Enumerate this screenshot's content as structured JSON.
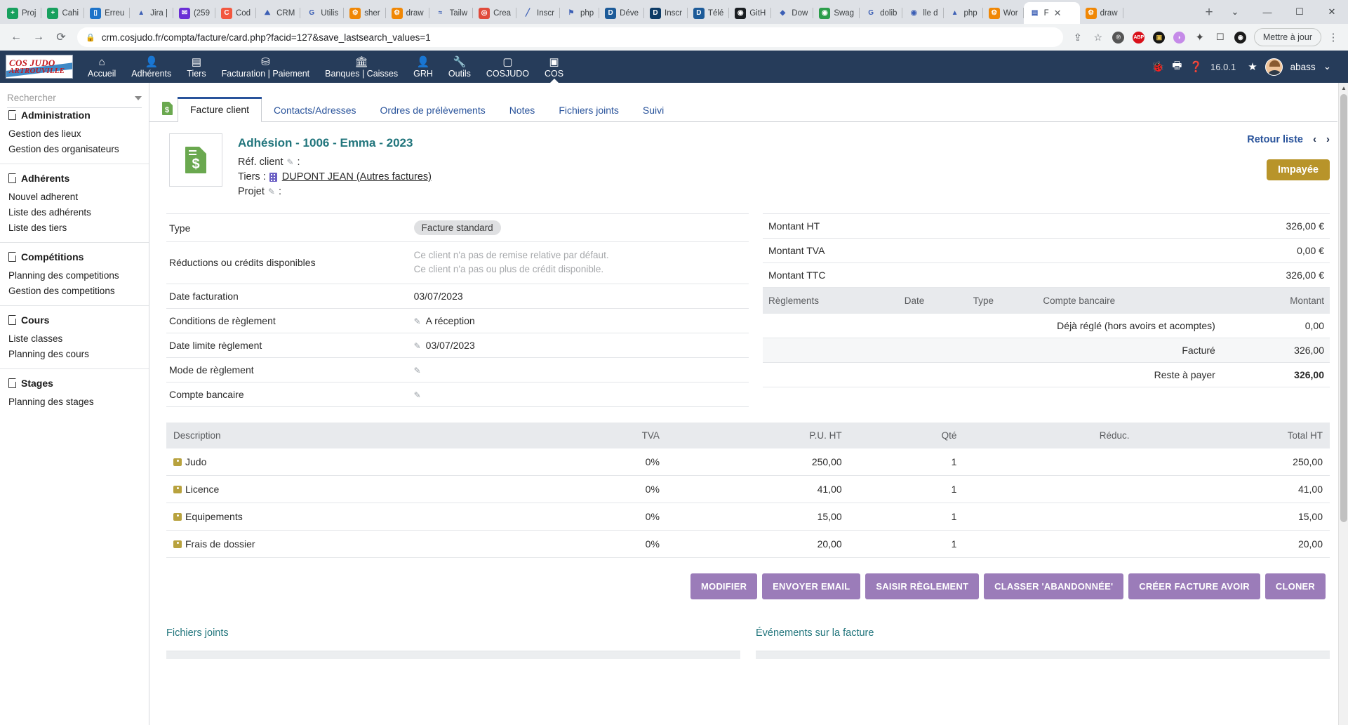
{
  "browser": {
    "tabs": [
      {
        "label": "Proj",
        "icon": "plus-square-green",
        "color": "#17a05e",
        "glyph": "+"
      },
      {
        "label": "Cahi",
        "icon": "plus-square-green",
        "color": "#17a05e",
        "glyph": "+"
      },
      {
        "label": "Erreu",
        "icon": "trello-icon",
        "color": "#1d73c9",
        "glyph": "▯"
      },
      {
        "label": "Jira |",
        "icon": "jira-icon",
        "color": "#ffffff",
        "glyph": "▲"
      },
      {
        "label": "(259",
        "icon": "mail-icon",
        "color": "#6b2fd6",
        "glyph": "✉"
      },
      {
        "label": "Cod",
        "icon": "codepen-icon",
        "color": "#f2573f",
        "glyph": "C"
      },
      {
        "label": "CRM",
        "icon": "crm-icon",
        "color": "#ffffff",
        "glyph": "⛰"
      },
      {
        "label": "Utilis",
        "icon": "google-icon",
        "color": "#ffffff",
        "glyph": "G"
      },
      {
        "label": "sher",
        "icon": "drawio-icon",
        "color": "#f08705",
        "glyph": "⚙"
      },
      {
        "label": "draw",
        "icon": "drawio-icon",
        "color": "#f08705",
        "glyph": "⚙"
      },
      {
        "label": "Tailw",
        "icon": "tailwind-icon",
        "color": "#ffffff",
        "glyph": "≈"
      },
      {
        "label": "Crea",
        "icon": "cred-icon",
        "color": "#e04a3a",
        "glyph": "◎"
      },
      {
        "label": "Inscr",
        "icon": "pen-icon",
        "color": "#ffffff",
        "glyph": "╱"
      },
      {
        "label": "php",
        "icon": "phpmyadmin-icon",
        "color": "#ffffff",
        "glyph": "⚑"
      },
      {
        "label": "Déve",
        "icon": "d-icon",
        "color": "#1d5b99",
        "glyph": "D"
      },
      {
        "label": "Inscr",
        "icon": "d-icon",
        "color": "#0d3b66",
        "glyph": "D"
      },
      {
        "label": "Télé",
        "icon": "d-icon",
        "color": "#1d5b99",
        "glyph": "D"
      },
      {
        "label": "GitH",
        "icon": "github-icon",
        "color": "#1b1f23",
        "glyph": "◉"
      },
      {
        "label": "Dow",
        "icon": "diamond-icon",
        "color": "#ffffff",
        "glyph": "◆"
      },
      {
        "label": "Swag",
        "icon": "swagger-icon",
        "color": "#2c9e4b",
        "glyph": "◉"
      },
      {
        "label": "dolib",
        "icon": "google-icon",
        "color": "#ffffff",
        "glyph": "G"
      },
      {
        "label": "lle d",
        "icon": "maps-pin-icon",
        "color": "#ffffff",
        "glyph": "◉"
      },
      {
        "label": "php",
        "icon": "drive-icon",
        "color": "#ffffff",
        "glyph": "▲"
      },
      {
        "label": "Wor",
        "icon": "drawio-icon",
        "color": "#f08705",
        "glyph": "⚙"
      },
      {
        "label": "F",
        "icon": "cosjudo-favicon",
        "color": "#ffffff",
        "glyph": "▤",
        "active": true
      },
      {
        "label": "draw",
        "icon": "drawio-icon",
        "color": "#f08705",
        "glyph": "⚙"
      }
    ],
    "newtab_label": "+",
    "window_controls": [
      "⌄",
      "—",
      "☐",
      "✕"
    ],
    "back_label": "←",
    "forward_label": "→",
    "reload_label": "⟳",
    "url": "crm.cosjudo.fr/compta/facture/card.php?facid=127&save_lastsearch_values=1",
    "lock_label": "🔒",
    "toolbar_icons": [
      {
        "name": "share-icon",
        "glyph": "⇪"
      },
      {
        "name": "bookmark-star-icon",
        "glyph": "☆"
      },
      {
        "name": "pinterest-extension-icon",
        "glyph": "◉"
      },
      {
        "name": "adblock-plus-icon",
        "glyph": "ABP"
      },
      {
        "name": "lion-extension-icon",
        "glyph": "▣"
      },
      {
        "name": "color-extension-icon",
        "glyph": "◗"
      },
      {
        "name": "extensions-puzzle-icon",
        "glyph": "✦"
      },
      {
        "name": "square-extension-icon",
        "glyph": "☐"
      },
      {
        "name": "dark-extension-icon",
        "glyph": "◉"
      }
    ],
    "update_label": "Mettre à jour",
    "menu_label": "⋮"
  },
  "app_header": {
    "logo_line1": "COS  JUDO",
    "logo_line2": "ARTROUVILLE",
    "nav": [
      {
        "label": "Accueil",
        "icon": "home-icon",
        "glyph": "⌂",
        "active": false
      },
      {
        "label": "Adhérents",
        "icon": "user-icon",
        "glyph": "👤",
        "active": false
      },
      {
        "label": "Tiers",
        "icon": "building-icon",
        "glyph": "▤",
        "active": false
      },
      {
        "label": "Facturation | Paiement",
        "icon": "coins-icon",
        "glyph": "⛁",
        "active": false
      },
      {
        "label": "Banques | Caisses",
        "icon": "bank-icon",
        "glyph": "🏛",
        "active": false
      },
      {
        "label": "GRH",
        "icon": "person-icon",
        "glyph": "👤",
        "active": false
      },
      {
        "label": "Outils",
        "icon": "wrench-icon",
        "glyph": "🔧",
        "active": false
      },
      {
        "label": "COSJUDO",
        "icon": "page-icon",
        "glyph": "▢",
        "active": false
      },
      {
        "label": "COS",
        "icon": "page-icon",
        "glyph": "▣",
        "active": true
      }
    ],
    "right": {
      "bug_icon": "bug-icon",
      "print_icon": "printer-icon",
      "help_icon": "help-icon",
      "version": "16.0.1",
      "star_icon": "star-icon",
      "username": "abass",
      "chevron": "⌄"
    }
  },
  "sidebar": {
    "search_placeholder": "Rechercher",
    "groups": [
      {
        "title": "Administration",
        "items": [
          "Gestion des lieux",
          "Gestion des organisateurs"
        ]
      },
      {
        "title": "Adhérents",
        "items": [
          "Nouvel adherent",
          "Liste des adhérents",
          "Liste des tiers"
        ]
      },
      {
        "title": "Compétitions",
        "items": [
          "Planning des competitions",
          "Gestion des competitions"
        ]
      },
      {
        "title": "Cours",
        "items": [
          "Liste classes",
          "Planning des cours"
        ]
      },
      {
        "title": "Stages",
        "items": [
          "Planning des stages"
        ]
      }
    ]
  },
  "doc_tabs": [
    {
      "label": "Facture client",
      "active": true
    },
    {
      "label": "Contacts/Adresses",
      "active": false
    },
    {
      "label": "Ordres de prélèvements",
      "active": false
    },
    {
      "label": "Notes",
      "active": false
    },
    {
      "label": "Fichiers joints",
      "active": false
    },
    {
      "label": "Suivi",
      "active": false
    }
  ],
  "invoice": {
    "title": "Adhésion - 1006 - Emma - 2023",
    "ref_client_label": "Réf. client",
    "ref_client_value": ":",
    "tiers_label": "Tiers :",
    "tiers_value": "DUPONT JEAN (Autres factures)",
    "projet_label": "Projet",
    "projet_value": ":",
    "retour_liste": "Retour liste",
    "prev_arrow": "‹",
    "next_arrow": "›",
    "status_badge": "Impayée",
    "status_color": "#b8942a"
  },
  "details": [
    {
      "label": "Type",
      "type": "chip",
      "value": "Facture standard"
    },
    {
      "label": "Réductions ou crédits disponibles",
      "type": "muted2",
      "value": "Ce client n'a pas de remise relative par défaut.",
      "value2": "Ce client n'a pas ou plus de crédit disponible."
    },
    {
      "label": "Date facturation",
      "type": "text",
      "value": "03/07/2023"
    },
    {
      "label": "Conditions de règlement",
      "type": "edit",
      "value": "A réception"
    },
    {
      "label": "Date limite règlement",
      "type": "edit",
      "value": "03/07/2023"
    },
    {
      "label": "Mode de règlement",
      "type": "edit",
      "value": ""
    },
    {
      "label": "Compte bancaire",
      "type": "edit",
      "value": ""
    }
  ],
  "amounts": [
    {
      "label": "Montant HT",
      "value": "326,00 €"
    },
    {
      "label": "Montant TVA",
      "value": "0,00 €"
    },
    {
      "label": "Montant TTC",
      "value": "326,00 €"
    }
  ],
  "payments": {
    "headers": [
      "Règlements",
      "Date",
      "Type",
      "Compte bancaire",
      "Montant"
    ],
    "rows": [
      {
        "label": "Déjà réglé (hors avoirs et acomptes)",
        "value": "0,00",
        "style": "normal"
      },
      {
        "label": "Facturé",
        "value": "326,00",
        "style": "shaded"
      },
      {
        "label": "Reste à payer",
        "value": "326,00",
        "style": "total"
      }
    ]
  },
  "lines": {
    "headers": [
      "Description",
      "TVA",
      "P.U. HT",
      "Qté",
      "Réduc.",
      "Total HT"
    ],
    "rows": [
      {
        "description": "Judo",
        "tva": "0%",
        "pu": "250,00",
        "qte": "1",
        "reduc": "",
        "total": "250,00"
      },
      {
        "description": "Licence",
        "tva": "0%",
        "pu": "41,00",
        "qte": "1",
        "reduc": "",
        "total": "41,00"
      },
      {
        "description": "Equipements",
        "tva": "0%",
        "pu": "15,00",
        "qte": "1",
        "reduc": "",
        "total": "15,00"
      },
      {
        "description": "Frais de dossier",
        "tva": "0%",
        "pu": "20,00",
        "qte": "1",
        "reduc": "",
        "total": "20,00"
      }
    ]
  },
  "actions": [
    "MODIFIER",
    "ENVOYER EMAIL",
    "SAISIR RÈGLEMENT",
    "CLASSER 'ABANDONNÉE'",
    "CRÉER FACTURE AVOIR",
    "CLONER"
  ],
  "bottom_sections": [
    {
      "title": "Fichiers joints"
    },
    {
      "title": "Événements sur la facture"
    }
  ]
}
